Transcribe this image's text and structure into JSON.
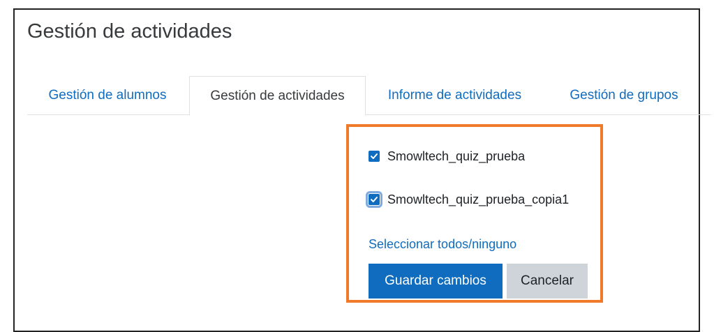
{
  "page": {
    "title": "Gestión de actividades"
  },
  "tabs": [
    {
      "label": "Gestión de alumnos",
      "active": false
    },
    {
      "label": "Gestión de actividades",
      "active": true
    },
    {
      "label": "Informe de actividades",
      "active": false
    },
    {
      "label": "Gestión de grupos",
      "active": false
    }
  ],
  "activities": [
    {
      "label": "Smowltech_quiz_prueba",
      "checked": true
    },
    {
      "label": "Smowltech_quiz_prueba_copia1",
      "checked": true
    }
  ],
  "select_all_link": "Seleccionar todos/ninguno",
  "buttons": {
    "save_label": "Guardar cambios",
    "cancel_label": "Cancelar"
  },
  "colors": {
    "accent": "#0f6cbf",
    "highlight_border": "#f07a2a",
    "secondary_button": "#ced4da"
  }
}
